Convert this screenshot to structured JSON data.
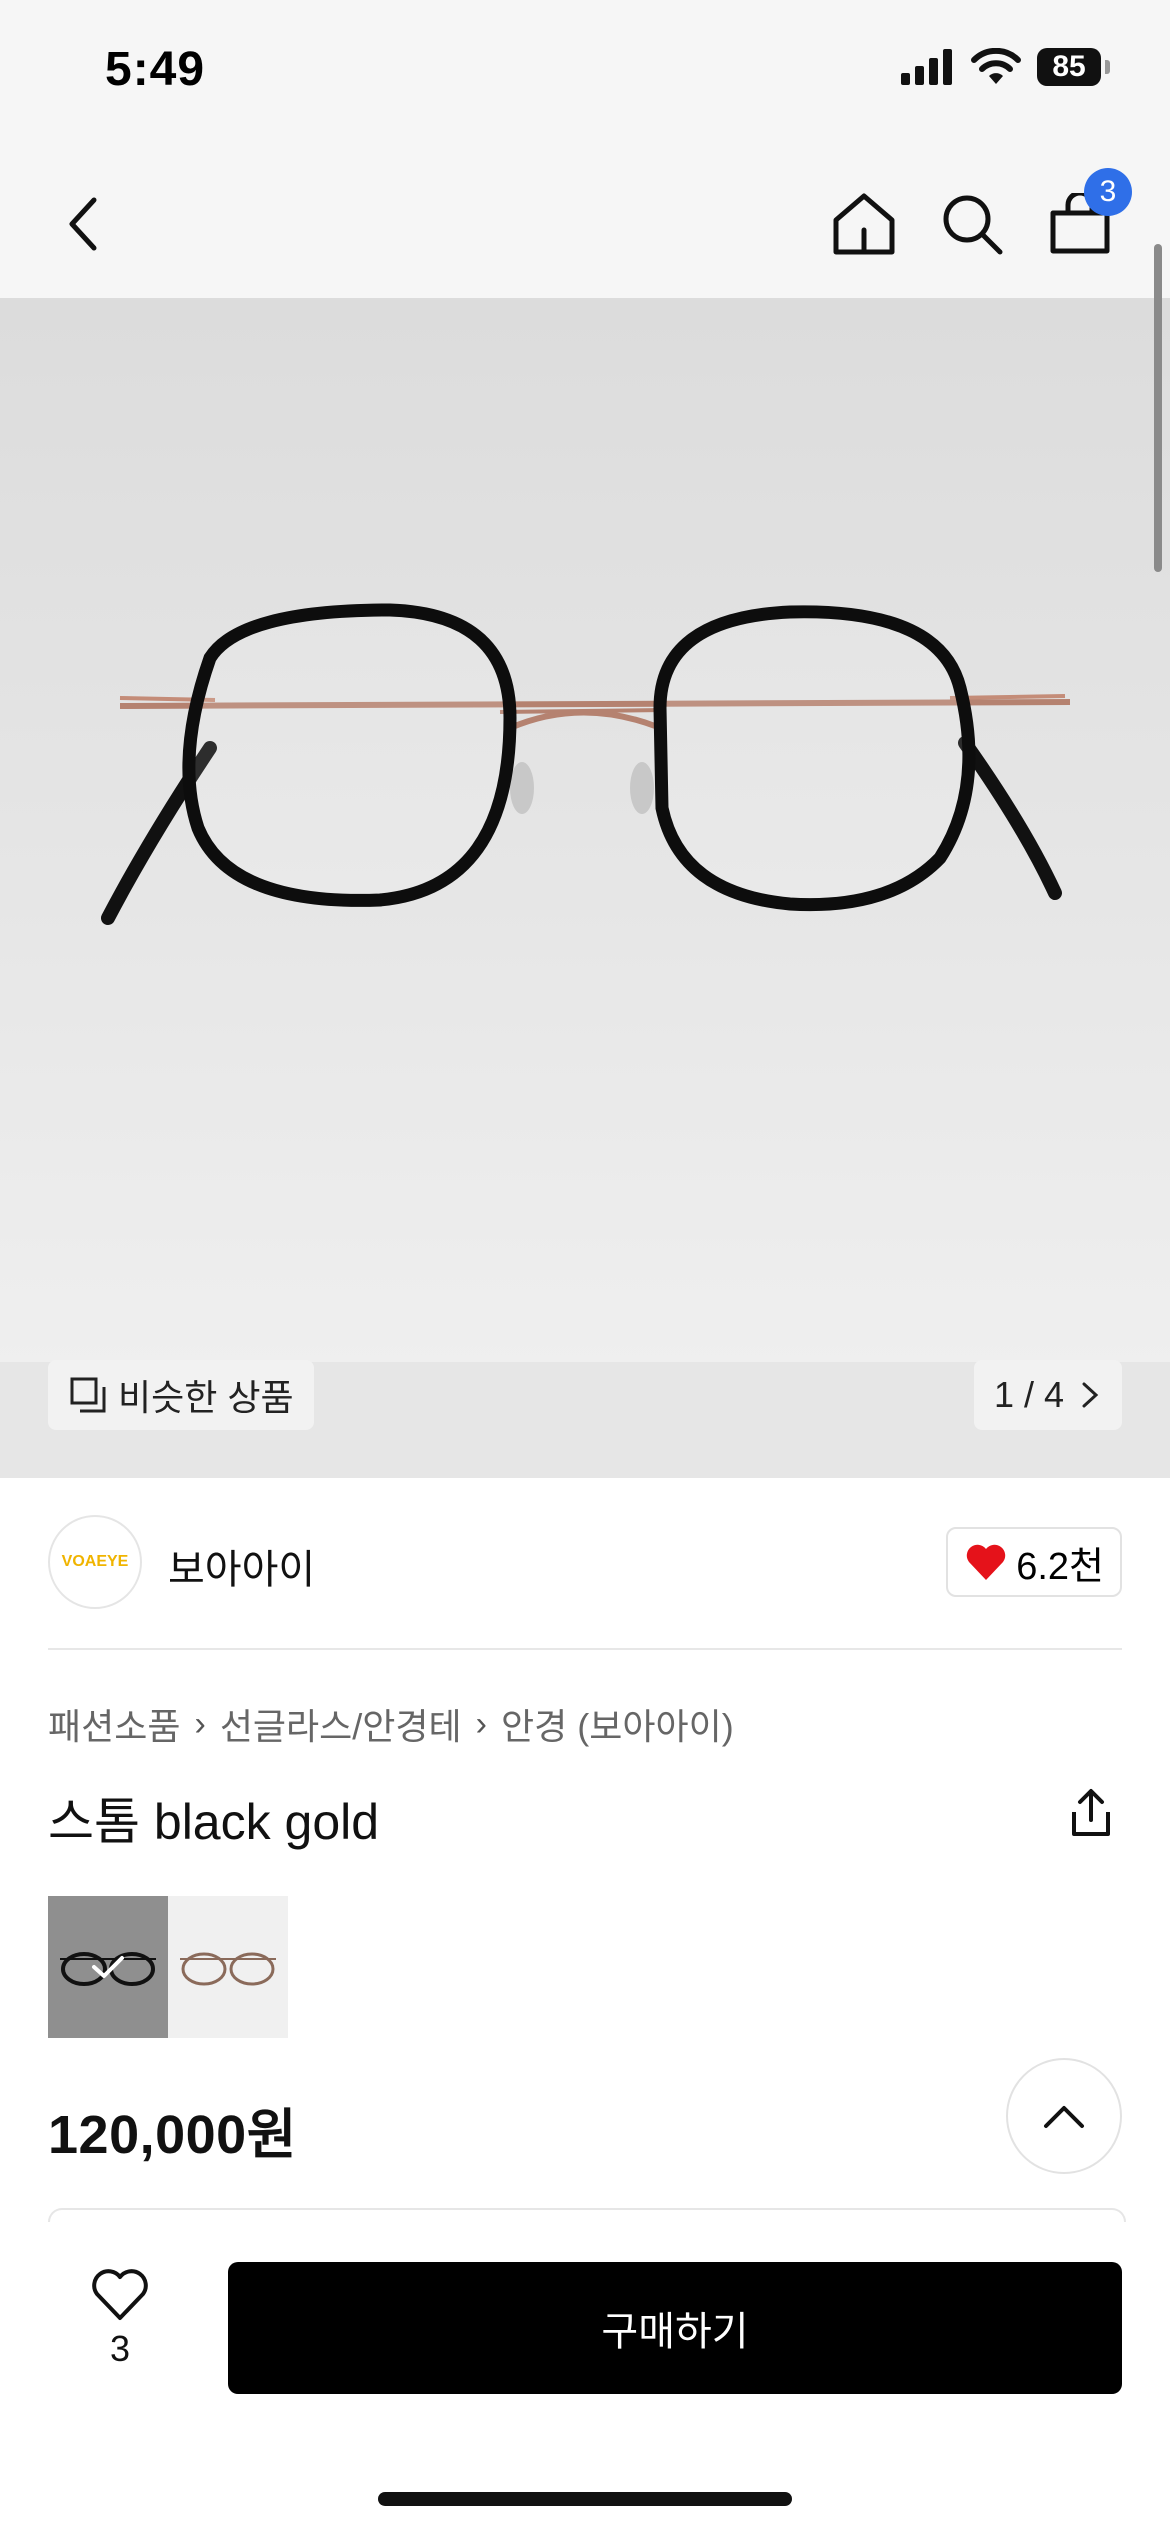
{
  "status_bar": {
    "time": "5:49",
    "battery": "85"
  },
  "nav": {
    "cart_count": "3"
  },
  "gallery": {
    "similar_label": "비슷한 상품",
    "pager": "1 / 4"
  },
  "brand": {
    "logo_text": "VOAEYE",
    "name": "보아아이",
    "likes": "6.2천"
  },
  "breadcrumb": [
    "패션소품",
    "선글라스/안경테",
    "안경 (보아아이)"
  ],
  "product": {
    "title": "스톰 black gold",
    "price": "120,000원"
  },
  "bottom": {
    "wish_count": "3",
    "buy_label": "구매하기"
  },
  "colors": {
    "accent": "#2f6fe8",
    "heart": "#e5121a",
    "buy_bg": "#000000"
  },
  "icons": [
    "back-icon",
    "home-icon",
    "search-icon",
    "bag-icon",
    "similar-icon",
    "chevron-right-icon",
    "heart-icon",
    "share-icon",
    "chevron-up-icon",
    "heart-outline-icon",
    "check-icon"
  ]
}
